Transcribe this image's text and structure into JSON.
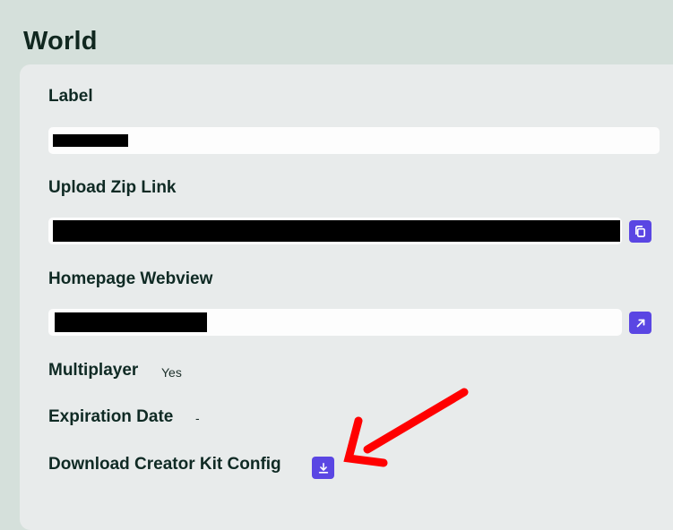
{
  "page": {
    "title": "World"
  },
  "fields": {
    "label": {
      "label": "Label",
      "value": ""
    },
    "upload_zip_link": {
      "label": "Upload Zip Link",
      "value": "",
      "action_icon": "copy-icon"
    },
    "homepage_webview": {
      "label": "Homepage Webview",
      "value": "",
      "action_icon": "external-link-icon"
    },
    "multiplayer": {
      "label": "Multiplayer",
      "value": "Yes"
    },
    "expiration_date": {
      "label": "Expiration Date",
      "value": "-"
    },
    "download_config": {
      "label": "Download Creator Kit Config",
      "action_icon": "download-icon"
    }
  },
  "colors": {
    "background": "#d5e0db",
    "card": "#e8ebeb",
    "accent": "#5a46e3",
    "annotation_arrow": "#ff0000"
  }
}
